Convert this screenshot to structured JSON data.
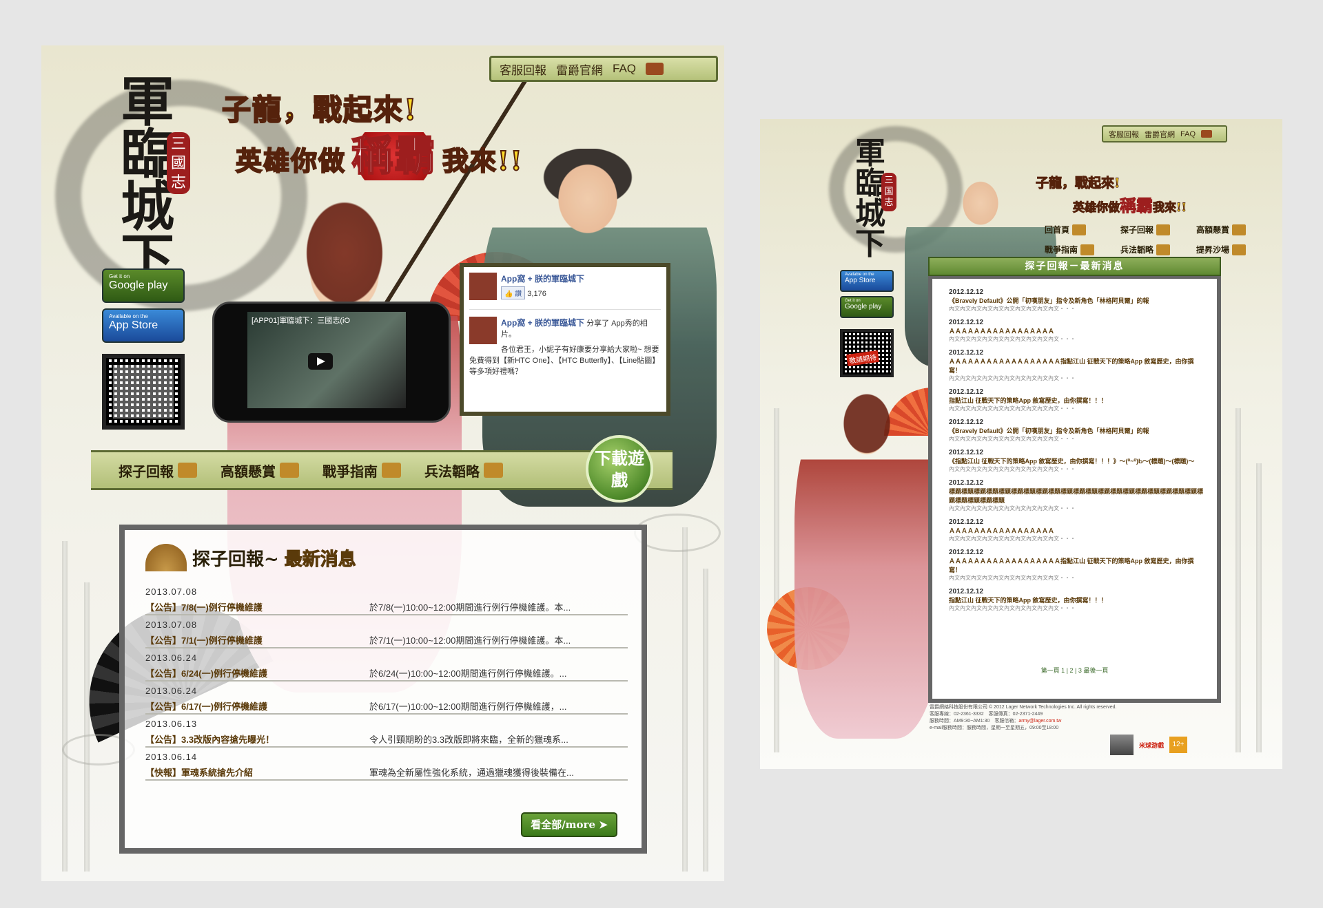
{
  "left": {
    "top_links": [
      "客服回報",
      "雷爵官網",
      "FAQ"
    ],
    "logo_title": "軍臨城下",
    "logo_seal": "三國志",
    "slogan1": "子龍，戰起來!",
    "slogan2_prefix": "英雄你做",
    "slogan2_big": "稱霸",
    "slogan2_suffix": "我來!!",
    "store_google": {
      "small": "Get it on",
      "big": "Google play"
    },
    "store_apple": {
      "small": "Available on the",
      "big": "App Store"
    },
    "video_title": "[APP01]軍臨城下：三國志(iO",
    "facebook": {
      "page_name": "App窩 + 朕的軍臨城下",
      "like_label": "讚",
      "like_count": "3,176",
      "post_author": "App窩 + 朕的軍臨城下",
      "post_action": "分享了 App秀的相片。",
      "post_body": "各位君王，小妮子有好康要分享給大家啦~ 想要免費得到【新HTC One】、【HTC Butterfly】、【Line貼圖】等多項好禮嗎？"
    },
    "nav": [
      "探子回報",
      "高額懸賞",
      "戰爭指南",
      "兵法韜略"
    ],
    "download": "下載遊戲",
    "news_title_a": "探子回報~",
    "news_title_b": "最新消息",
    "news": [
      {
        "date": "2013.07.08",
        "title": "【公告】7/8(一)例行停機維護",
        "desc": "於7/8(一)10:00~12:00期間進行例行停機維護。本..."
      },
      {
        "date": "2013.07.08",
        "title": "【公告】7/1(一)例行停機維護",
        "desc": "於7/1(一)10:00~12:00期間進行例行停機維護。本..."
      },
      {
        "date": "2013.06.24",
        "title": "【公告】6/24(一)例行停機維護",
        "desc": "於6/24(一)10:00~12:00期間進行例行停機維護。..."
      },
      {
        "date": "2013.06.24",
        "title": "【公告】6/17(一)例行停機維護",
        "desc": "於6/17(一)10:00~12:00期間進行例行停機維護，..."
      },
      {
        "date": "2013.06.13",
        "title": "【公告】3.3改版內容搶先曝光！",
        "desc": "令人引頸期盼的3.3改版即將來臨，全新的獵魂系..."
      },
      {
        "date": "2013.06.14",
        "title": "【快報】軍魂系統搶先介紹",
        "desc": "軍魂為全新屬性強化系統，通過獵魂獲得後裝備在..."
      }
    ],
    "more": "看全部/more ➤"
  },
  "right": {
    "top_links": [
      "客服回報",
      "雷爵官網",
      "FAQ"
    ],
    "logo_title": "軍臨城下",
    "logo_seal": "三国志",
    "slogan1": "子龍，戰起來!",
    "slogan2_prefix": "英雄你做",
    "slogan2_big": "稱霸",
    "slogan2_suffix": "我來!!",
    "nav": [
      "回首頁",
      "探子回報",
      "高額懸賞",
      "戰爭指南",
      "兵法韜略",
      "提昇沙場"
    ],
    "store_apple": {
      "small": "Available on the",
      "big": "App Store"
    },
    "store_google": {
      "small": "Get it on",
      "big": "Google play"
    },
    "qr_tag": "敬請期待",
    "news_header": "探子回報－最新消息",
    "news": [
      {
        "date": "2012.12.12",
        "title": "《Bravely Default》公開「初嘆朋友」指令及新角色「林格阿貝爾」的報",
        "sub": "內文內文內文內文內文內文內文內文內文內文・・・"
      },
      {
        "date": "2012.12.12",
        "title": "ＡＡＡＡＡＡＡＡＡＡＡＡＡＡＡＡＡ",
        "sub": "內文內文內文內文內文內文內文內文內文內文・・・"
      },
      {
        "date": "2012.12.12",
        "title": "ＡＡＡＡＡＡＡＡＡＡＡＡＡＡＡＡＡＡ指點江山 征戰天下的策略App 敘寫歷史，由你撰寫！",
        "sub": "內文內文內文內文內文內文內文內文內文內文・・・"
      },
      {
        "date": "2012.12.12",
        "title": "指點江山 征戰天下的策略App 敘寫歷史，由你撰寫！！！",
        "sub": "內文內文內文內文內文內文內文內文內文內文・・・"
      },
      {
        "date": "2012.12.12",
        "title": "《Bravely Default》公開「初嘆朋友」指令及新角色「林格阿貝爾」的報",
        "sub": "內文內文內文內文內文內文內文內文內文內文・・・"
      },
      {
        "date": "2012.12.12",
        "title": "《指點江山 征戰天下的策略App 敘寫歷史，由你撰寫！！！》～(⁰~⁰)Ь～(標題)～(標題)～",
        "sub": "內文內文內文內文內文內文內文內文內文內文・・・"
      },
      {
        "date": "2012.12.12",
        "title": "標題標題標題標題標題標題標題標題標題標題標題標題標題標題標題標題標題標題標題標題標題標題標題標題標題",
        "sub": "內文內文內文內文內文內文內文內文內文內文・・・"
      },
      {
        "date": "2012.12.12",
        "title": "ＡＡＡＡＡＡＡＡＡＡＡＡＡＡＡＡＡ",
        "sub": "內文內文內文內文內文內文內文內文內文內文・・・"
      },
      {
        "date": "2012.12.12",
        "title": "ＡＡＡＡＡＡＡＡＡＡＡＡＡＡＡＡＡＡ指點江山 征戰天下的策略App 敘寫歷史，由你撰寫！",
        "sub": "內文內文內文內文內文內文內文內文內文內文・・・"
      },
      {
        "date": "2012.12.12",
        "title": "指點江山 征戰天下的策略App 敘寫歷史，由你撰寫！！！",
        "sub": "內文內文內文內文內文內文內文內文內文內文・・・"
      }
    ],
    "pager": {
      "first": "第一頁",
      "p1": "1",
      "p2": "2",
      "p3": "3",
      "last": "最後一頁"
    },
    "footer": {
      "line1": "雷爵網絡科技股份有限公司 © 2012 Lager Network Technologies Inc. All rights reserved.",
      "line2": "客服專線：02-2361-3332　客服傳真：02-2371-2449",
      "line3_prefix": "服務時間：AM9:30~AM1:30　客服信箱：",
      "email": "army@lager.com.tw",
      "line4": "e-mail服務時間：服務時間，星期一至星期五，09:00至18:00",
      "brand": "米球游戲",
      "rating": "12+"
    }
  }
}
